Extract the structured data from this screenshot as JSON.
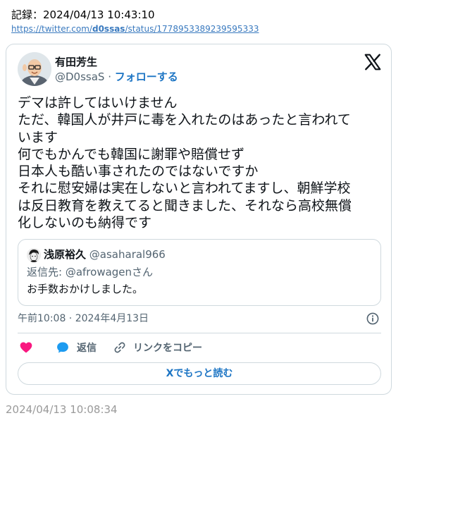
{
  "record": {
    "label": "記録：2024/04/13 10:43:10",
    "link_prefix": "https://twitter.com/",
    "link_user": "d0ssas",
    "link_suffix": "/status/1778953389239595333"
  },
  "tweet": {
    "author_name": "有田芳生",
    "author_handle": "@D0ssaS",
    "separator": "·",
    "follow_label": "フォローする",
    "text_lines": [
      "デマは許してはいけません",
      "ただ、韓国人が井戸に毒を入れたのはあったと言われて",
      "います",
      "何でもかんでも韓国に謝罪や賠償せず",
      "日本人も酷い事されたのではないですか",
      "それに慰安婦は実在しないと言われてますし、朝鮮学校",
      "は反日教育を教えてると聞きました、それなら高校無償",
      "化しないのも納得です"
    ],
    "quote": {
      "name": "浅原裕久",
      "handle": "@asaharal966",
      "reply_prefix": "返信先: ",
      "reply_handle": "@afrowagen",
      "reply_suffix": "さん",
      "text": "お手数おかけしました。"
    },
    "timestamp": "午前10:08 · 2024年4月13日",
    "actions": {
      "reply_label": "返信",
      "copy_link_label": "リンクをコピー"
    },
    "read_more_label": "Xでもっと読む"
  },
  "captured_at": "2024/04/13 10:08:34",
  "colors": {
    "link_blue": "#1d75c4",
    "like_pink": "#f91880",
    "reply_blue": "#1d9bf0",
    "muted_gray": "#536471",
    "border": "#cfd9de"
  },
  "icons": [
    "x-logo-icon",
    "info-icon",
    "heart-icon",
    "speech-bubble-icon",
    "link-icon"
  ]
}
